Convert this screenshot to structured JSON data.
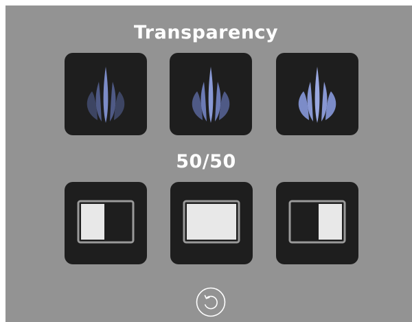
{
  "transparency": {
    "title": "Transparency",
    "options": [
      {
        "icon": "transparency-low-icon",
        "level": 0.33
      },
      {
        "icon": "transparency-medium-icon",
        "level": 0.66
      },
      {
        "icon": "transparency-high-icon",
        "level": 1.0
      }
    ]
  },
  "split": {
    "title": "50/50",
    "options": [
      {
        "icon": "split-left-icon"
      },
      {
        "icon": "split-full-icon"
      },
      {
        "icon": "split-right-icon"
      }
    ]
  },
  "reset": {
    "icon": "reset-icon"
  },
  "colors": {
    "background": "#939393",
    "tile": "#1e1e1e",
    "drop_accent": "#7c8cc8",
    "preview_fill": "#e8e8e8"
  }
}
